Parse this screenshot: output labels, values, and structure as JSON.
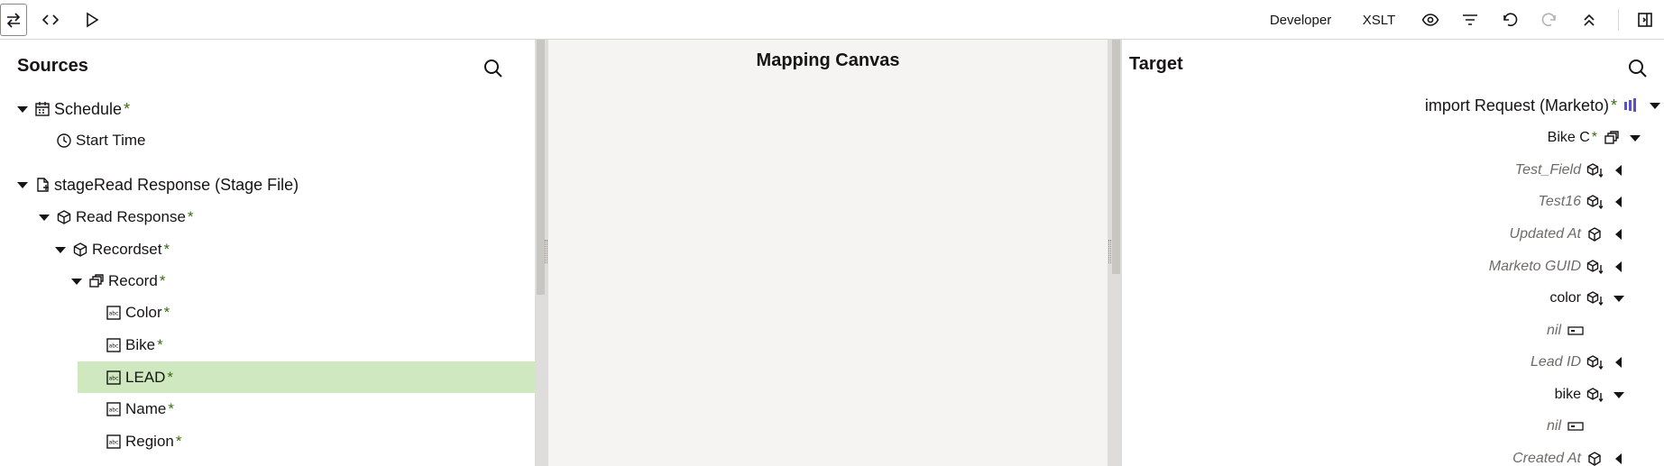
{
  "toolbar": {
    "mode_label": "Developer",
    "xslt_label": "XSLT"
  },
  "sources": {
    "title": "Sources",
    "required_mark": "*",
    "items": [
      {
        "label": "Schedule",
        "required": true,
        "icon": "calendar-icon",
        "expanded": true
      },
      {
        "label": "Start Time",
        "required": false,
        "icon": "clock-icon"
      },
      {
        "label": "stageRead Response (Stage File)",
        "required": false,
        "icon": "file-icon",
        "expanded": true
      },
      {
        "label": "Read Response",
        "required": true,
        "icon": "cube-icon",
        "expanded": true
      },
      {
        "label": "Recordset",
        "required": true,
        "icon": "cube-icon",
        "expanded": true
      },
      {
        "label": "Record",
        "required": true,
        "icon": "collection-icon",
        "expanded": true
      },
      {
        "label": "Color",
        "required": true,
        "icon": "text-field-icon"
      },
      {
        "label": "Bike",
        "required": true,
        "icon": "text-field-icon"
      },
      {
        "label": "LEAD",
        "required": true,
        "icon": "text-field-icon",
        "selected": true
      },
      {
        "label": "Name",
        "required": true,
        "icon": "text-field-icon"
      },
      {
        "label": "Region",
        "required": true,
        "icon": "text-field-icon"
      }
    ]
  },
  "canvas": {
    "title": "Mapping Canvas"
  },
  "target": {
    "title": "Target",
    "items": [
      {
        "label": "import Request (Marketo)",
        "required": true,
        "icon": "marketo-icon",
        "arrow": "down"
      },
      {
        "label": "Bike C",
        "required": true,
        "icon": "collection-icon",
        "arrow": "down"
      },
      {
        "label": "Test_Field",
        "italic": true,
        "icon": "cube-sort-icon",
        "arrow": "left"
      },
      {
        "label": "Test16",
        "italic": true,
        "icon": "cube-sort-icon",
        "arrow": "left"
      },
      {
        "label": "Updated At",
        "italic": true,
        "icon": "cube-icon",
        "arrow": "left"
      },
      {
        "label": "Marketo GUID",
        "italic": true,
        "icon": "cube-sort-icon",
        "arrow": "left"
      },
      {
        "label": "color",
        "italic": false,
        "icon": "cube-sort-icon",
        "arrow": "down"
      },
      {
        "label": "nil",
        "italic": true,
        "icon": "attribute-icon"
      },
      {
        "label": "Lead ID",
        "italic": true,
        "icon": "cube-sort-icon",
        "arrow": "left"
      },
      {
        "label": "bike",
        "italic": false,
        "icon": "cube-sort-icon",
        "arrow": "down"
      },
      {
        "label": "nil",
        "italic": true,
        "icon": "attribute-icon"
      },
      {
        "label": "Created At",
        "italic": true,
        "icon": "cube-icon",
        "arrow": "left"
      }
    ]
  },
  "colors": {
    "selected_row": "#cfe8c0",
    "required_mark": "#3d6b12",
    "canvas_bg": "#f5f4f2",
    "marketo_accent": "#5a4fcf"
  }
}
